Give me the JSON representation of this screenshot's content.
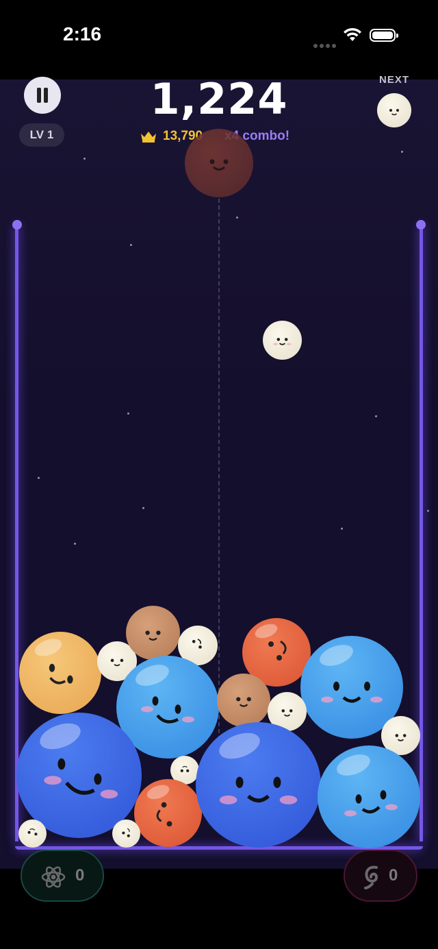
{
  "status": {
    "time": "2:16"
  },
  "hud": {
    "level": "LV 1",
    "score": "1,224",
    "best": "13,790",
    "combo": "x4 combo!",
    "next_label": "NEXT"
  },
  "powerups": {
    "atom_count": "0",
    "swirl_count": "0"
  },
  "colors": {
    "wall": "#7557e6",
    "best": "#f2c230",
    "combo": "#9b7cf6"
  },
  "balls": [
    {
      "kind": "ghost-mars",
      "falling_preview": true
    },
    {
      "kind": "moon",
      "state": "falling"
    },
    {
      "kind": "moon",
      "state": "next"
    },
    {
      "kind": "gold"
    },
    {
      "kind": "moon"
    },
    {
      "kind": "tan"
    },
    {
      "kind": "moon"
    },
    {
      "kind": "red"
    },
    {
      "kind": "blue"
    },
    {
      "kind": "blue"
    },
    {
      "kind": "tan"
    },
    {
      "kind": "moon"
    },
    {
      "kind": "moon"
    },
    {
      "kind": "dblue"
    },
    {
      "kind": "moon"
    },
    {
      "kind": "red"
    },
    {
      "kind": "dblue"
    },
    {
      "kind": "blue"
    },
    {
      "kind": "moon"
    },
    {
      "kind": "moon"
    }
  ]
}
